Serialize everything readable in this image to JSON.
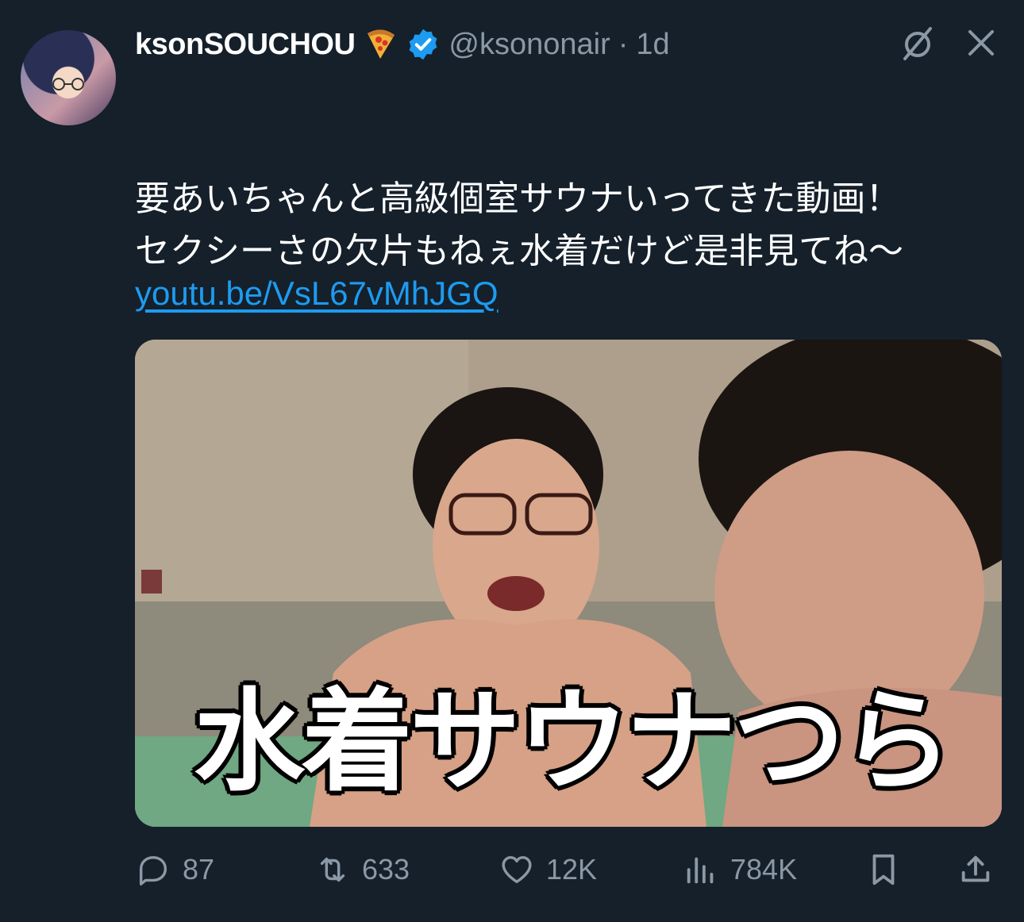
{
  "tweet": {
    "display_name": "ksonSOUCHOU",
    "handle": "@ksononair",
    "separator": "·",
    "time": "1d",
    "text": "要あいちゃんと高級個室サウナいってきた動画！\nセクシーさの欠片もねぇ水着だけど是非見てね～",
    "link": "youtu.be/VsL67vMhJGQ",
    "media_caption": "水着サウナつら"
  },
  "actions": {
    "replies": "87",
    "reposts": "633",
    "likes": "12K",
    "views": "784K"
  },
  "icons": [
    "grok-icon",
    "close-icon",
    "reply-icon",
    "repost-icon",
    "like-icon",
    "views-icon",
    "bookmark-icon",
    "share-icon",
    "verified-badge-icon",
    "pizza-emoji-icon",
    "heart-emoji-icon"
  ],
  "colors": {
    "background": "#15202b",
    "link": "#1d9bf0",
    "secondary_text": "#8b98a5",
    "verified": "#1d9bf0"
  }
}
